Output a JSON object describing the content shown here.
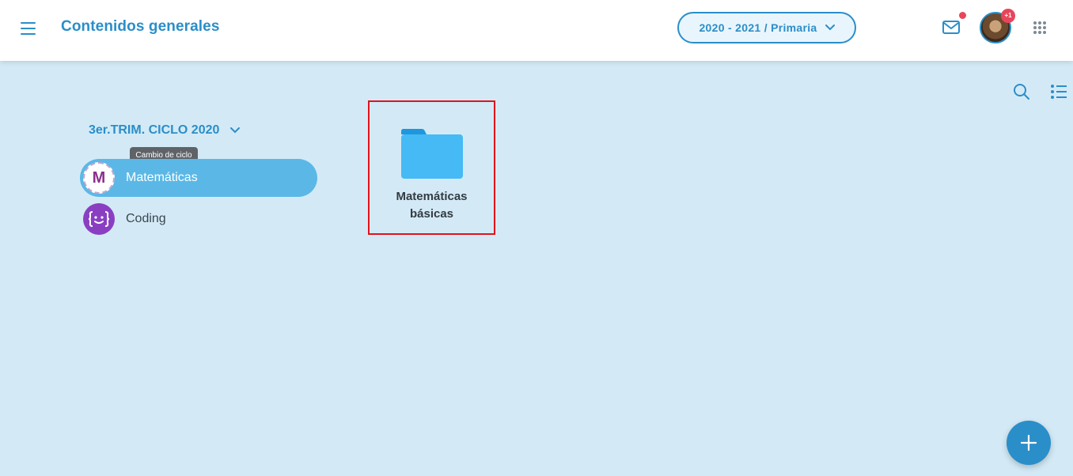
{
  "header": {
    "title": "Contenidos generales",
    "year_select": "2020 - 2021 / Primaria",
    "avatar_badge": "+1"
  },
  "sidebar": {
    "cycle_label": "3er.TRIM. CICLO 2020",
    "cycle_tooltip": "Cambio de ciclo",
    "subjects": [
      {
        "label": "Matemáticas",
        "icon_letter": "M",
        "active": true
      },
      {
        "label": "Coding",
        "icon": "code-face-icon",
        "active": false
      }
    ]
  },
  "content": {
    "folders": [
      {
        "name": "Matemáticas básicas"
      }
    ]
  },
  "colors": {
    "accent": "#2a8ec9",
    "background": "#d3eaf6",
    "active_item": "#5bb8e6",
    "folder": "#45baf5",
    "highlight_border": "#e2121b",
    "badge": "#e8455b"
  },
  "icons": [
    "menu-icon",
    "chevron-down-icon",
    "mail-icon",
    "apps-grid-icon",
    "search-icon",
    "list-view-icon",
    "folder-icon",
    "plus-icon"
  ]
}
